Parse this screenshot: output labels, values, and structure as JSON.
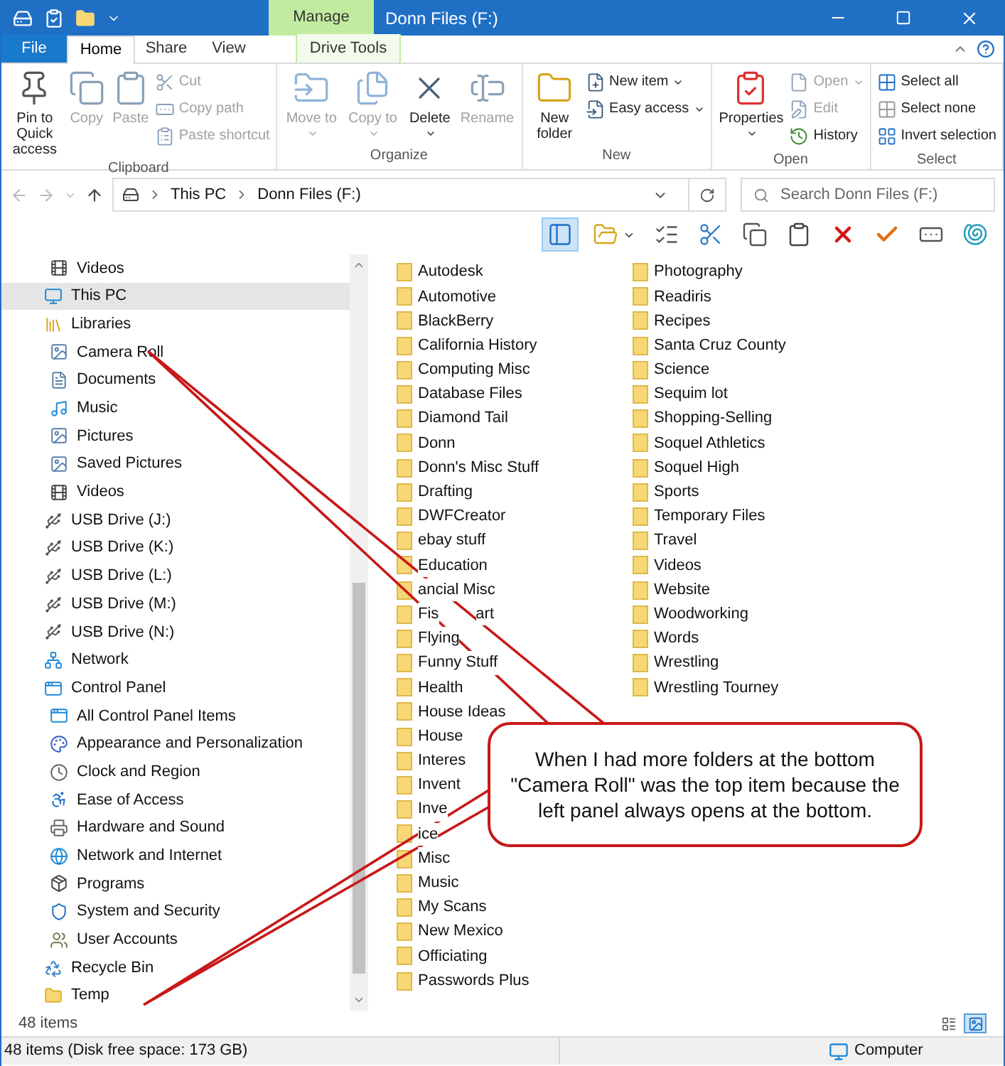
{
  "window": {
    "title": "Donn Files (F:)",
    "contextual_tab": "Manage"
  },
  "tabs": [
    {
      "label": "File",
      "kind": "file",
      "selected": false
    },
    {
      "label": "Home",
      "kind": "normal",
      "selected": true
    },
    {
      "label": "Share",
      "kind": "normal",
      "selected": false
    },
    {
      "label": "View",
      "kind": "normal",
      "selected": false
    },
    {
      "label": "Drive Tools",
      "kind": "contextual",
      "selected": false
    }
  ],
  "ribbon": [
    {
      "label": "Clipboard",
      "columns": [
        {
          "kind": "large",
          "commands": [
            {
              "kind": "pin",
              "label": "Pin to Quick access",
              "disabled": false,
              "dropdown": false
            }
          ]
        },
        {
          "kind": "large",
          "commands": [
            {
              "kind": "copy",
              "label": "Copy",
              "disabled": true,
              "dropdown": false
            }
          ]
        },
        {
          "kind": "large",
          "commands": [
            {
              "kind": "paste",
              "label": "Paste",
              "disabled": true,
              "dropdown": false
            }
          ]
        },
        {
          "kind": "stack",
          "commands": [
            {
              "kind": "cut",
              "label": "Cut",
              "disabled": true,
              "dropdown": false
            },
            {
              "kind": "copypath",
              "label": "Copy path",
              "disabled": true,
              "dropdown": false
            },
            {
              "kind": "pasteshortcut",
              "label": "Paste shortcut",
              "disabled": true,
              "dropdown": false
            }
          ]
        }
      ]
    },
    {
      "label": "Organize",
      "columns": [
        {
          "kind": "large",
          "commands": [
            {
              "kind": "move",
              "label": "Move to",
              "disabled": true,
              "dropdown": true
            }
          ]
        },
        {
          "kind": "large",
          "commands": [
            {
              "kind": "copyto",
              "label": "Copy to",
              "disabled": true,
              "dropdown": true
            }
          ]
        },
        {
          "kind": "large",
          "commands": [
            {
              "kind": "delete",
              "label": "Delete",
              "disabled": false,
              "dropdown": true
            }
          ]
        },
        {
          "kind": "large",
          "commands": [
            {
              "kind": "rename",
              "label": "Rename",
              "disabled": true,
              "dropdown": false
            }
          ]
        }
      ]
    },
    {
      "label": "New",
      "columns": [
        {
          "kind": "large",
          "commands": [
            {
              "kind": "newfolder",
              "label": "New folder",
              "disabled": false,
              "dropdown": false
            }
          ]
        },
        {
          "kind": "stack",
          "commands": [
            {
              "kind": "newitem",
              "label": "New item",
              "disabled": false,
              "dropdown": true
            },
            {
              "kind": "easyaccess",
              "label": "Easy access",
              "disabled": false,
              "dropdown": true
            }
          ]
        }
      ]
    },
    {
      "label": "Open",
      "columns": [
        {
          "kind": "large",
          "commands": [
            {
              "kind": "properties",
              "label": "Properties",
              "disabled": false,
              "dropdown": true
            }
          ]
        },
        {
          "kind": "stack",
          "commands": [
            {
              "kind": "open",
              "label": "Open",
              "disabled": true,
              "dropdown": true
            },
            {
              "kind": "edit",
              "label": "Edit",
              "disabled": true,
              "dropdown": false
            },
            {
              "kind": "history",
              "label": "History",
              "disabled": false,
              "dropdown": false
            }
          ]
        }
      ]
    },
    {
      "label": "Select",
      "columns": [
        {
          "kind": "stack",
          "commands": [
            {
              "kind": "selectall",
              "label": "Select all",
              "disabled": false,
              "dropdown": false
            },
            {
              "kind": "selectnone",
              "label": "Select none",
              "disabled": false,
              "dropdown": false
            },
            {
              "kind": "invert",
              "label": "Invert selection",
              "disabled": false,
              "dropdown": false
            }
          ]
        }
      ]
    }
  ],
  "address": {
    "breadcrumbs": [
      "This PC",
      "Donn Files (F:)"
    ],
    "search_placeholder": "Search Donn Files (F:)"
  },
  "toolbar": [
    {
      "kind": "pane",
      "selected": true
    },
    {
      "kind": "folderview",
      "selected": false
    },
    {
      "kind": "checklist",
      "selected": false
    },
    {
      "kind": "cut",
      "selected": false
    },
    {
      "kind": "copy",
      "selected": false
    },
    {
      "kind": "paste",
      "selected": false
    },
    {
      "kind": "delete",
      "selected": false
    },
    {
      "kind": "check",
      "selected": false
    },
    {
      "kind": "rename",
      "selected": false
    },
    {
      "kind": "shell",
      "selected": false
    }
  ],
  "nav_tree": {
    "continued": [
      {
        "label": "Videos",
        "kind": "video",
        "selected": false
      }
    ],
    "items": [
      {
        "label": "This PC",
        "kind": "pc",
        "selected": true
      },
      {
        "label": "Libraries",
        "kind": "library",
        "selected": false,
        "children": [
          {
            "label": "Camera Roll",
            "kind": "pictures",
            "selected": false
          },
          {
            "label": "Documents",
            "kind": "documents",
            "selected": false
          },
          {
            "label": "Music",
            "kind": "music",
            "selected": false
          },
          {
            "label": "Pictures",
            "kind": "pictures",
            "selected": false
          },
          {
            "label": "Saved Pictures",
            "kind": "pictures",
            "selected": false
          },
          {
            "label": "Videos",
            "kind": "video",
            "selected": false
          }
        ]
      },
      {
        "label": "USB Drive (J:)",
        "kind": "usb",
        "selected": false
      },
      {
        "label": "USB Drive (K:)",
        "kind": "usb",
        "selected": false
      },
      {
        "label": "USB Drive (L:)",
        "kind": "usb",
        "selected": false
      },
      {
        "label": "USB Drive (M:)",
        "kind": "usb",
        "selected": false
      },
      {
        "label": "USB Drive (N:)",
        "kind": "usb",
        "selected": false
      },
      {
        "label": "Network",
        "kind": "network",
        "selected": false
      },
      {
        "label": "Control Panel",
        "kind": "control",
        "selected": false,
        "children": [
          {
            "label": "All Control Panel Items",
            "kind": "control",
            "selected": false
          },
          {
            "label": "Appearance and Personalization",
            "kind": "appearance",
            "selected": false
          },
          {
            "label": "Clock and Region",
            "kind": "clock",
            "selected": false
          },
          {
            "label": "Ease of Access",
            "kind": "access",
            "selected": false
          },
          {
            "label": "Hardware and Sound",
            "kind": "hardware",
            "selected": false
          },
          {
            "label": "Network and Internet",
            "kind": "internet",
            "selected": false
          },
          {
            "label": "Programs",
            "kind": "programs",
            "selected": false
          },
          {
            "label": "System and Security",
            "kind": "security",
            "selected": false
          },
          {
            "label": "User Accounts",
            "kind": "users",
            "selected": false
          }
        ]
      },
      {
        "label": "Recycle Bin",
        "kind": "recycle",
        "selected": false
      },
      {
        "label": "Temp",
        "kind": "folder",
        "selected": false
      }
    ]
  },
  "folder_columns": [
    [
      {
        "label": "Autodesk"
      },
      {
        "label": "Automotive"
      },
      {
        "label": "BlackBerry"
      },
      {
        "label": "California History"
      },
      {
        "label": "Computing Misc"
      },
      {
        "label": "Database Files"
      },
      {
        "label": "Diamond Tail"
      },
      {
        "label": "Donn"
      },
      {
        "label": "Donn's Misc Stuff"
      },
      {
        "label": "Drafting"
      },
      {
        "label": "DWFCreator"
      },
      {
        "label": "ebay stuff"
      },
      {
        "label": "Education"
      },
      {
        "label": "ancial Misc"
      },
      {
        "label": "Fis",
        "tail": "art"
      },
      {
        "label": "Flying"
      },
      {
        "label": "Funny Stuff"
      },
      {
        "label": "Health"
      },
      {
        "label": "House Ideas"
      },
      {
        "label": "House"
      },
      {
        "label": "Interes"
      },
      {
        "label": "Invent"
      },
      {
        "label": "Inve"
      },
      {
        "label": "ice"
      },
      {
        "label": "Misc"
      },
      {
        "label": "Music"
      },
      {
        "label": "My Scans"
      },
      {
        "label": "New Mexico"
      },
      {
        "label": "Officiating"
      },
      {
        "label": "Passwords Plus"
      }
    ],
    [
      {
        "label": "Photography"
      },
      {
        "label": "Readiris"
      },
      {
        "label": "Recipes"
      },
      {
        "label": "Santa Cruz County"
      },
      {
        "label": "Science"
      },
      {
        "label": "Sequim lot"
      },
      {
        "label": "Shopping-Selling"
      },
      {
        "label": "Soquel Athletics"
      },
      {
        "label": "Soquel High"
      },
      {
        "label": "Sports"
      },
      {
        "label": "Temporary Files"
      },
      {
        "label": "Travel"
      },
      {
        "label": "Videos"
      },
      {
        "label": "Website"
      },
      {
        "label": "Woodworking"
      },
      {
        "label": "Words"
      },
      {
        "label": "Wrestling"
      },
      {
        "label": "Wrestling Tourney"
      }
    ]
  ],
  "callout": {
    "text": "When I had more folders at the bottom \"Camera Roll\" was the top item because the left panel always opens at the bottom."
  },
  "status": {
    "items": "48 items",
    "views": [
      {
        "kind": "details",
        "selected": false
      },
      {
        "kind": "large",
        "selected": true
      }
    ]
  },
  "bottom_bar": {
    "text": "48 items (Disk free space: 173 GB)",
    "location": "Computer"
  }
}
